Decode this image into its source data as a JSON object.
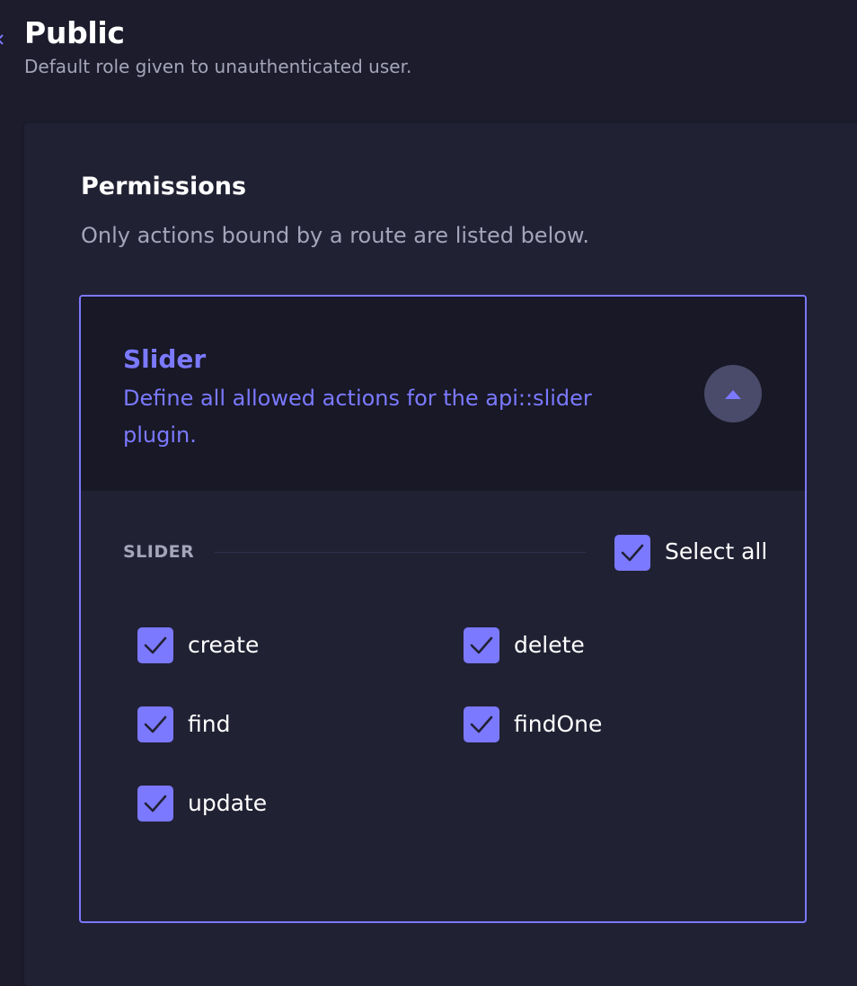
{
  "header": {
    "title": "Public",
    "subtitle": "Default role given to unauthenticated user."
  },
  "permissions": {
    "title": "Permissions",
    "description": "Only actions bound by a route are listed below."
  },
  "accordion": {
    "title": "Slider",
    "description": "Define all allowed actions for the api::slider plugin.",
    "expanded": true,
    "section_label": "SLIDER",
    "select_all": {
      "label": "Select all",
      "checked": true
    },
    "actions": [
      {
        "label": "create",
        "checked": true
      },
      {
        "label": "delete",
        "checked": true
      },
      {
        "label": "find",
        "checked": true
      },
      {
        "label": "findOne",
        "checked": true
      },
      {
        "label": "update",
        "checked": true
      }
    ]
  },
  "colors": {
    "accent": "#7b79ff",
    "background": "#1c1c2c",
    "panel": "#212134",
    "accordion_header": "#181826",
    "muted_text": "#a5a5ba"
  },
  "icons": {
    "back": "arrow-left-icon",
    "collapse": "chevron-up-icon",
    "checkbox": "check-icon"
  }
}
